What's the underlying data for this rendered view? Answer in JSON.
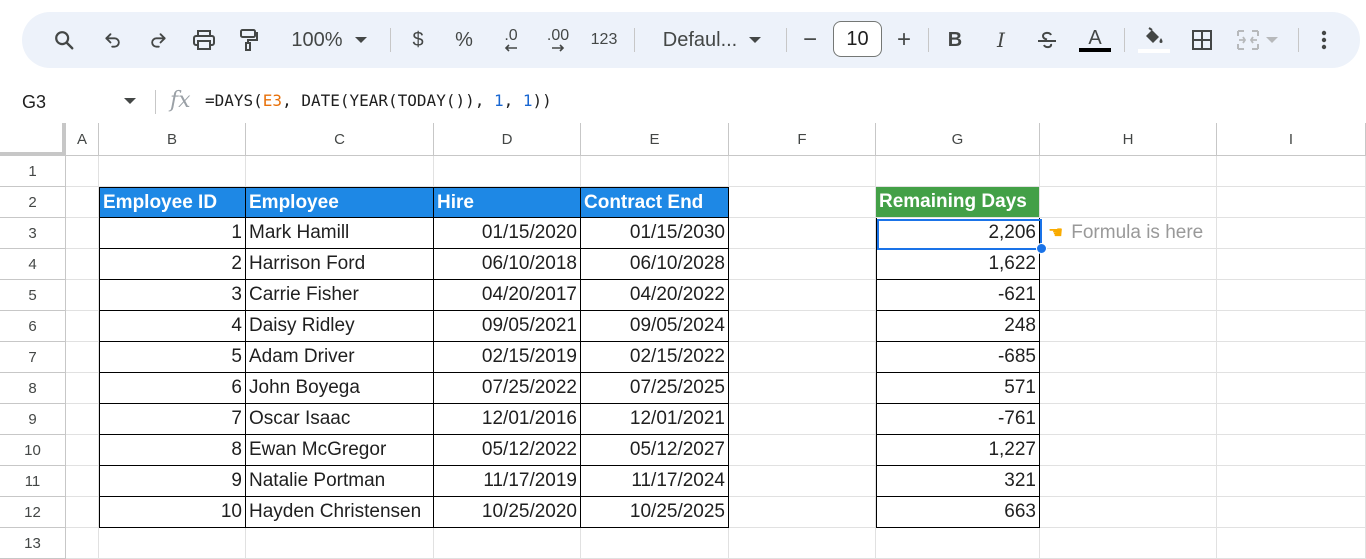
{
  "toolbar": {
    "zoom": "100%",
    "currency": "$",
    "percent": "%",
    "decrease_decimal": ".0",
    "increase_decimal": ".00",
    "number_format": "123",
    "font": "Defaul...",
    "font_size": "10",
    "minus": "−",
    "plus": "+",
    "bold": "B",
    "italic": "I",
    "text_color": "A",
    "icons": [
      "search-icon",
      "undo-icon",
      "redo-icon",
      "print-icon",
      "paint-format-icon",
      "strikethrough-icon",
      "fill-color-icon",
      "borders-icon",
      "merge-cells-icon",
      "more-vert-icon"
    ]
  },
  "formula_bar": {
    "name_box": "G3",
    "fx": "fx",
    "formula_parts": {
      "p1": "=DAYS(",
      "ref": "E3",
      "p2": ", DATE(YEAR(TODAY()), ",
      "n1": "1",
      "p3": ", ",
      "n2": "1",
      "p4": "))"
    }
  },
  "sheet": {
    "columns": [
      "A",
      "B",
      "C",
      "D",
      "E",
      "F",
      "G",
      "H",
      "I"
    ],
    "rows": [
      "1",
      "2",
      "3",
      "4",
      "5",
      "6",
      "7",
      "8",
      "9",
      "10",
      "11",
      "12",
      "13"
    ],
    "table_headers": [
      "Employee ID",
      "Employee",
      "Hire",
      "Contract End"
    ],
    "result_header": "Remaining Days",
    "table_rows": [
      [
        "1",
        "Mark Hamill",
        "01/15/2020",
        "01/15/2030",
        "2,206"
      ],
      [
        "2",
        "Harrison Ford",
        "06/10/2018",
        "06/10/2028",
        "1,622"
      ],
      [
        "3",
        "Carrie Fisher",
        "04/20/2017",
        "04/20/2022",
        "-621"
      ],
      [
        "4",
        "Daisy Ridley",
        "09/05/2021",
        "09/05/2024",
        "248"
      ],
      [
        "5",
        "Adam Driver",
        "02/15/2019",
        "02/15/2022",
        "-685"
      ],
      [
        "6",
        "John Boyega",
        "07/25/2022",
        "07/25/2025",
        "571"
      ],
      [
        "7",
        "Oscar Isaac",
        "12/01/2016",
        "12/01/2021",
        "-761"
      ],
      [
        "8",
        "Ewan McGregor",
        "05/12/2022",
        "05/12/2027",
        "1,227"
      ],
      [
        "9",
        "Natalie Portman",
        "11/17/2019",
        "11/17/2024",
        "321"
      ],
      [
        "10",
        "Hayden Christensen",
        "10/25/2020",
        "10/25/2025",
        "663"
      ]
    ],
    "note": "Formula is here",
    "note_icon": "pointing-hand-icon",
    "colors": {
      "header_blue": "#1e88e5",
      "header_green": "#43a047",
      "selection": "#1a73e8",
      "formula_ref": "#e8710a",
      "formula_number": "#1967d2"
    }
  }
}
